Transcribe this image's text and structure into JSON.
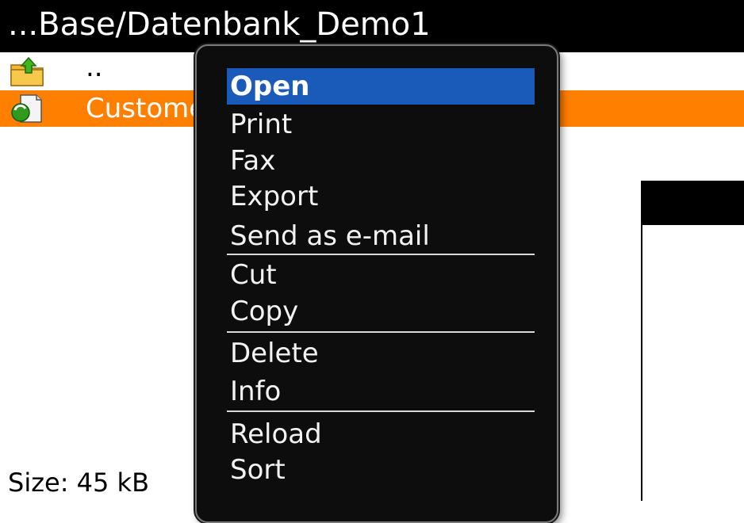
{
  "titlebar": {
    "title": "...Base/Datenbank_Demo1"
  },
  "files": [
    {
      "name": "..",
      "icon": "folder-up-icon",
      "selected": false
    },
    {
      "name": "Customers.dbs",
      "icon": "database-file-icon",
      "selected": true
    }
  ],
  "status": {
    "size_text": "Size: 45 kB"
  },
  "context_menu": {
    "items": [
      {
        "label": "Open",
        "selected": true
      },
      {
        "label": "Print"
      },
      {
        "label": "Fax"
      },
      {
        "label": "Export"
      },
      {
        "label": "Send as e-mail"
      },
      {
        "label": "Cut"
      },
      {
        "label": "Copy"
      },
      {
        "label": "Delete"
      },
      {
        "label": "Info"
      },
      {
        "label": "Reload"
      },
      {
        "label": "Sort"
      }
    ]
  },
  "colors": {
    "selection_orange": "#ff7f00",
    "menu_highlight": "#1a5ab8",
    "menu_background": "#0d0d0d"
  }
}
